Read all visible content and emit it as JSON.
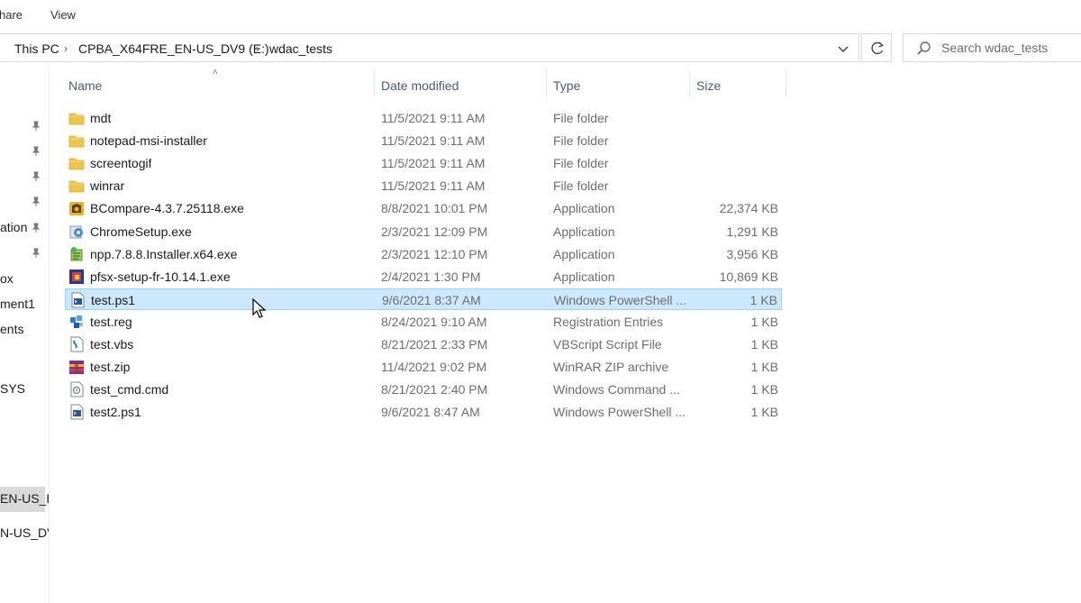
{
  "ribbon": {
    "share_label": "hare",
    "view_label": "View"
  },
  "address": {
    "crumbs": [
      "This PC",
      "CPBA_X64FRE_EN-US_DV9 (E:)",
      "wdac_tests"
    ]
  },
  "search": {
    "placeholder": "Search wdac_tests"
  },
  "nav": {
    "labels": [
      "ation",
      "ox",
      "ment1",
      "ents",
      "SYS",
      "EN-US_D",
      "N-US_DV"
    ]
  },
  "columns": {
    "name": "Name",
    "date": "Date modified",
    "type": "Type",
    "size": "Size"
  },
  "files": [
    {
      "name": "mdt",
      "date": "11/5/2021 9:11 AM",
      "type": "File folder",
      "size": "",
      "icon": "folder-icon"
    },
    {
      "name": "notepad-msi-installer",
      "date": "11/5/2021 9:11 AM",
      "type": "File folder",
      "size": "",
      "icon": "folder-icon"
    },
    {
      "name": "screentogif",
      "date": "11/5/2021 9:11 AM",
      "type": "File folder",
      "size": "",
      "icon": "folder-icon"
    },
    {
      "name": "winrar",
      "date": "11/5/2021 9:11 AM",
      "type": "File folder",
      "size": "",
      "icon": "folder-icon"
    },
    {
      "name": "BCompare-4.3.7.25118.exe",
      "date": "8/8/2021 10:01 PM",
      "type": "Application",
      "size": "22,374 KB",
      "icon": "bcompare-icon"
    },
    {
      "name": "ChromeSetup.exe",
      "date": "2/3/2021 12:09 PM",
      "type": "Application",
      "size": "1,291 KB",
      "icon": "chrome-setup-icon"
    },
    {
      "name": "npp.7.8.8.Installer.x64.exe",
      "date": "2/3/2021 12:10 PM",
      "type": "Application",
      "size": "3,956 KB",
      "icon": "notepadpp-icon"
    },
    {
      "name": "pfsx-setup-fr-10.14.1.exe",
      "date": "2/4/2021 1:30 PM",
      "type": "Application",
      "size": "10,869 KB",
      "icon": "pfsx-icon"
    },
    {
      "name": "test.ps1",
      "date": "9/6/2021 8:37 AM",
      "type": "Windows PowerShell ...",
      "size": "1 KB",
      "icon": "powershell-file-icon",
      "selected": true
    },
    {
      "name": "test.reg",
      "date": "8/24/2021 9:10 AM",
      "type": "Registration Entries",
      "size": "1 KB",
      "icon": "registry-file-icon"
    },
    {
      "name": "test.vbs",
      "date": "8/21/2021 2:33 PM",
      "type": "VBScript Script File",
      "size": "1 KB",
      "icon": "vbscript-file-icon"
    },
    {
      "name": "test.zip",
      "date": "11/4/2021 9:02 PM",
      "type": "WinRAR ZIP archive",
      "size": "1 KB",
      "icon": "winrar-archive-icon"
    },
    {
      "name": "test_cmd.cmd",
      "date": "8/21/2021 2:40 PM",
      "type": "Windows Command ...",
      "size": "1 KB",
      "icon": "cmd-file-icon"
    },
    {
      "name": "test2.ps1",
      "date": "9/6/2021 8:47 AM",
      "type": "Windows PowerShell ...",
      "size": "1 KB",
      "icon": "powershell-file-icon"
    }
  ],
  "colors": {
    "selection_bg": "#cce8ff",
    "selection_border": "#99d1ff",
    "folder": "#f0c44b",
    "header_text": "#4a5a78"
  }
}
